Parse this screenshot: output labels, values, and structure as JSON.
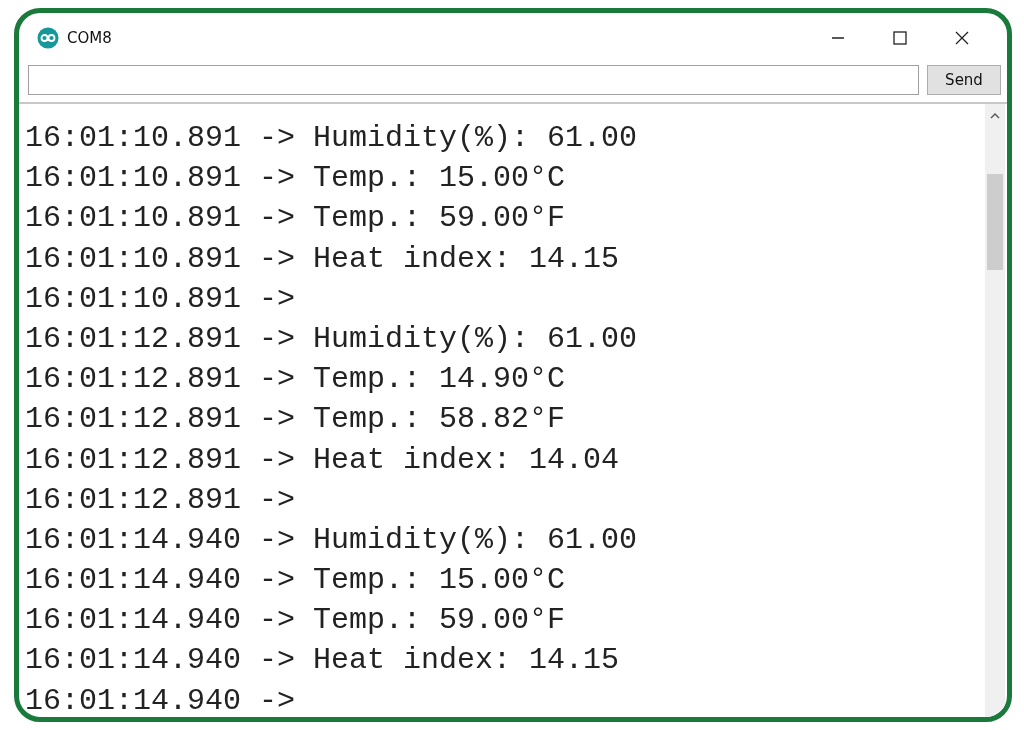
{
  "window": {
    "title": "COM8"
  },
  "send_button": {
    "label": "Send"
  },
  "lines": [
    "16:01:10.891 -> Humidity(%): 61.00",
    "16:01:10.891 -> Temp.: 15.00°C",
    "16:01:10.891 -> Temp.: 59.00°F",
    "16:01:10.891 -> Heat index: 14.15",
    "16:01:10.891 ->",
    "16:01:12.891 -> Humidity(%): 61.00",
    "16:01:12.891 -> Temp.: 14.90°C",
    "16:01:12.891 -> Temp.: 58.82°F",
    "16:01:12.891 -> Heat index: 14.04",
    "16:01:12.891 ->",
    "16:01:14.940 -> Humidity(%): 61.00",
    "16:01:14.940 -> Temp.: 15.00°C",
    "16:01:14.940 -> Temp.: 59.00°F",
    "16:01:14.940 -> Heat index: 14.15",
    "16:01:14.940 ->"
  ]
}
